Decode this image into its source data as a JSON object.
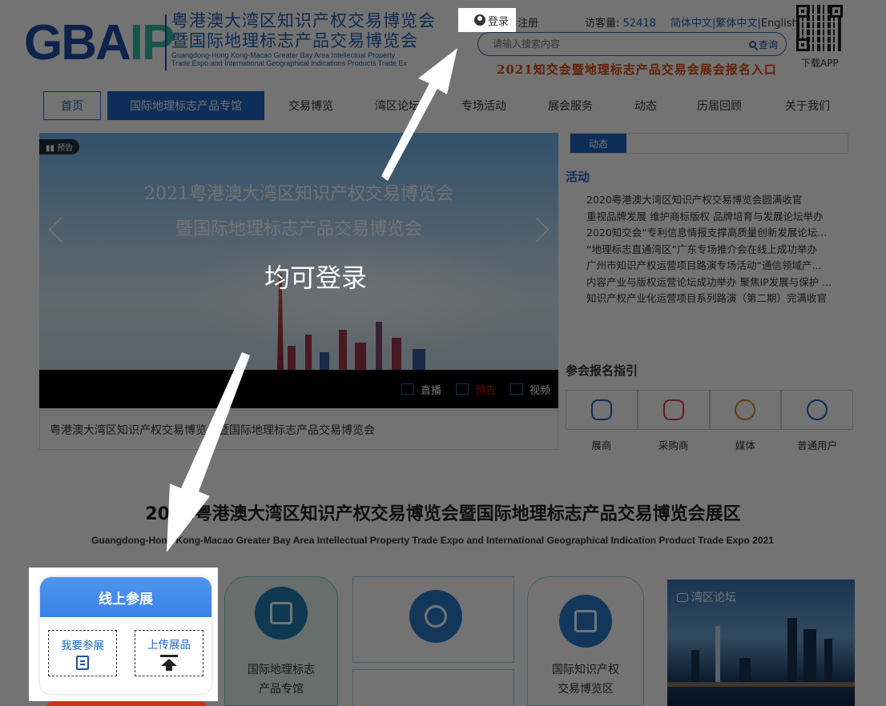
{
  "header": {
    "logo_letters": "GBA",
    "logo_letters_accent": "IP",
    "logo_cn_line1": "粤港澳大湾区知识产权交易博览会",
    "logo_cn_line2": "暨国际地理标志产品交易博览会",
    "logo_en_line1": "Guangdong-Hong Kong-Macao Greater Bay Area Intellectual Property",
    "logo_en_line2": "Trade Expo and International Geographical Indications Products Trade Ex",
    "login_label": "登录",
    "register_label": "注册",
    "visits_label": "访客量:",
    "visits_count": "52418",
    "lang_simplified": "简体中文|",
    "lang_traditional": "繁体中文|",
    "lang_english": "English",
    "search_placeholder": "请输入搜索内容",
    "search_button": "查询",
    "signup_banner": "2021知交会暨地理标志产品交易会展会报名入口",
    "app_label": "下载APP"
  },
  "nav": {
    "items": [
      "首页",
      "国际地理标志产品专馆",
      "交易博览",
      "湾区论坛",
      "专场活动",
      "展会服务",
      "动态",
      "历届回顾",
      "关于我们"
    ]
  },
  "banner": {
    "tag": "预告",
    "title_line1": "2021粤港澳大湾区知识产权交易博览会",
    "title_line2": "暨国际地理标志产品交易博览会",
    "media": [
      "直播",
      "预告",
      "视频"
    ],
    "caption": "粤港澳大湾区知识产权交易博览会暨国际地理标志产品交易博览会"
  },
  "news": {
    "tab": "动态",
    "heading": "活动",
    "items": [
      "2020粤港澳大湾区知识产权交易博览会圆满收官",
      "重视品牌发展 维护商标版权 品牌培育与发展论坛举办",
      "2020知交会“专利信息情报支撑高质量创新发展论坛...",
      "“地理标志直通湾区”广东专场推介会在线上成功举办",
      "广州市知识产权运营项目路演专场活动“通信领域产...",
      "内容产业与版权运营论坛成功举办 聚焦IP发展与保护 ...",
      "知识产权产业化运营项目系列路演（第二期）完满收官"
    ]
  },
  "guide": {
    "heading": "参会报名指引",
    "items": [
      "展商",
      "采购商",
      "媒体",
      "普通用户"
    ]
  },
  "expo": {
    "title": "2021粤港澳大湾区知识产权交易博览会暨国际地理标志产品交易博览会展区",
    "subtitle": "Guangdong-Hong Kong-Macao Greater Bay Area Intellectual Property Trade Expo and  International Geographical Indication Product Trade Expo 2021",
    "online_title": "线上参展",
    "online_exhibit": "我要参展",
    "online_upload": "上传展品",
    "card_gi_line1": "国际地理标志",
    "card_gi_line2": "产品专馆",
    "card_ip_line1": "国际知识产权",
    "card_ip_line2": "交易博览区",
    "forum_tag": "湾区论坛"
  },
  "annotation": {
    "text": "均可登录"
  }
}
